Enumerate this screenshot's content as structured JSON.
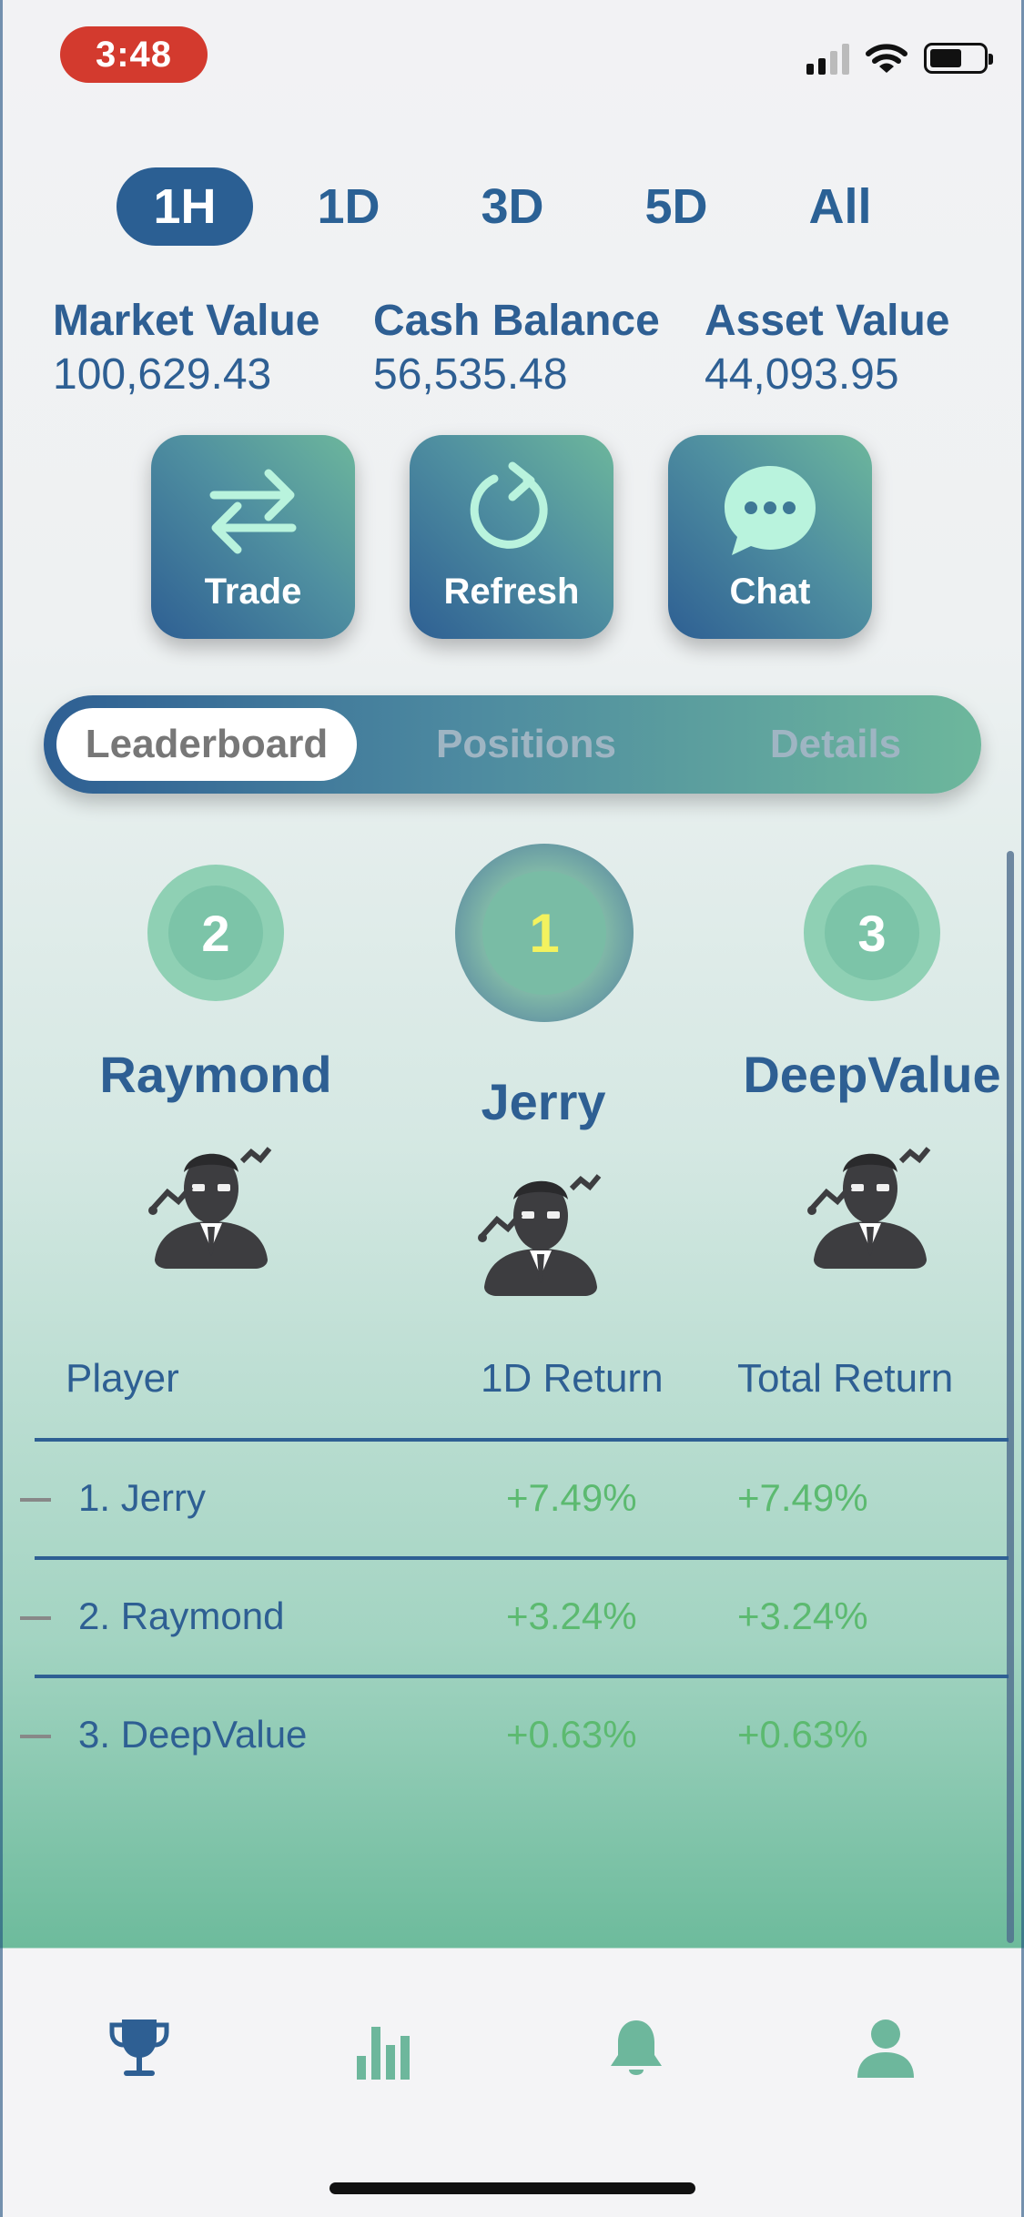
{
  "status": {
    "time": "3:48"
  },
  "periods": [
    "1H",
    "1D",
    "3D",
    "5D",
    "All"
  ],
  "active_period": "1H",
  "metrics": [
    {
      "label": "Market Value",
      "value": "100,629.43"
    },
    {
      "label": "Cash Balance",
      "value": "56,535.48"
    },
    {
      "label": "Asset Value",
      "value": "44,093.95"
    }
  ],
  "actions": {
    "trade": "Trade",
    "refresh": "Refresh",
    "chat": "Chat"
  },
  "segments": [
    "Leaderboard",
    "Positions",
    "Details"
  ],
  "active_segment": "Leaderboard",
  "podium": {
    "first": {
      "rank": "1",
      "name": "Jerry"
    },
    "second": {
      "rank": "2",
      "name": "Raymond"
    },
    "third": {
      "rank": "3",
      "name": "DeepValue"
    }
  },
  "table": {
    "headers": {
      "player": "Player",
      "d1": "1D Return",
      "total": "Total Return"
    },
    "rows": [
      {
        "player": "1. Jerry",
        "d1": "+7.49%",
        "total": "+7.49%"
      },
      {
        "player": "2. Raymond",
        "d1": "+3.24%",
        "total": "+3.24%"
      },
      {
        "player": "3. DeepValue",
        "d1": "+0.63%",
        "total": "+0.63%"
      }
    ]
  },
  "tabbar": {
    "icons": [
      "trophy-icon",
      "bar-chart-icon",
      "bell-icon",
      "person-icon"
    ],
    "active": "trophy-icon"
  },
  "colors": {
    "primary": "#2e5f93",
    "accent": "#6db79c",
    "positive": "#5cba70",
    "time_pill": "#d33a2e"
  }
}
